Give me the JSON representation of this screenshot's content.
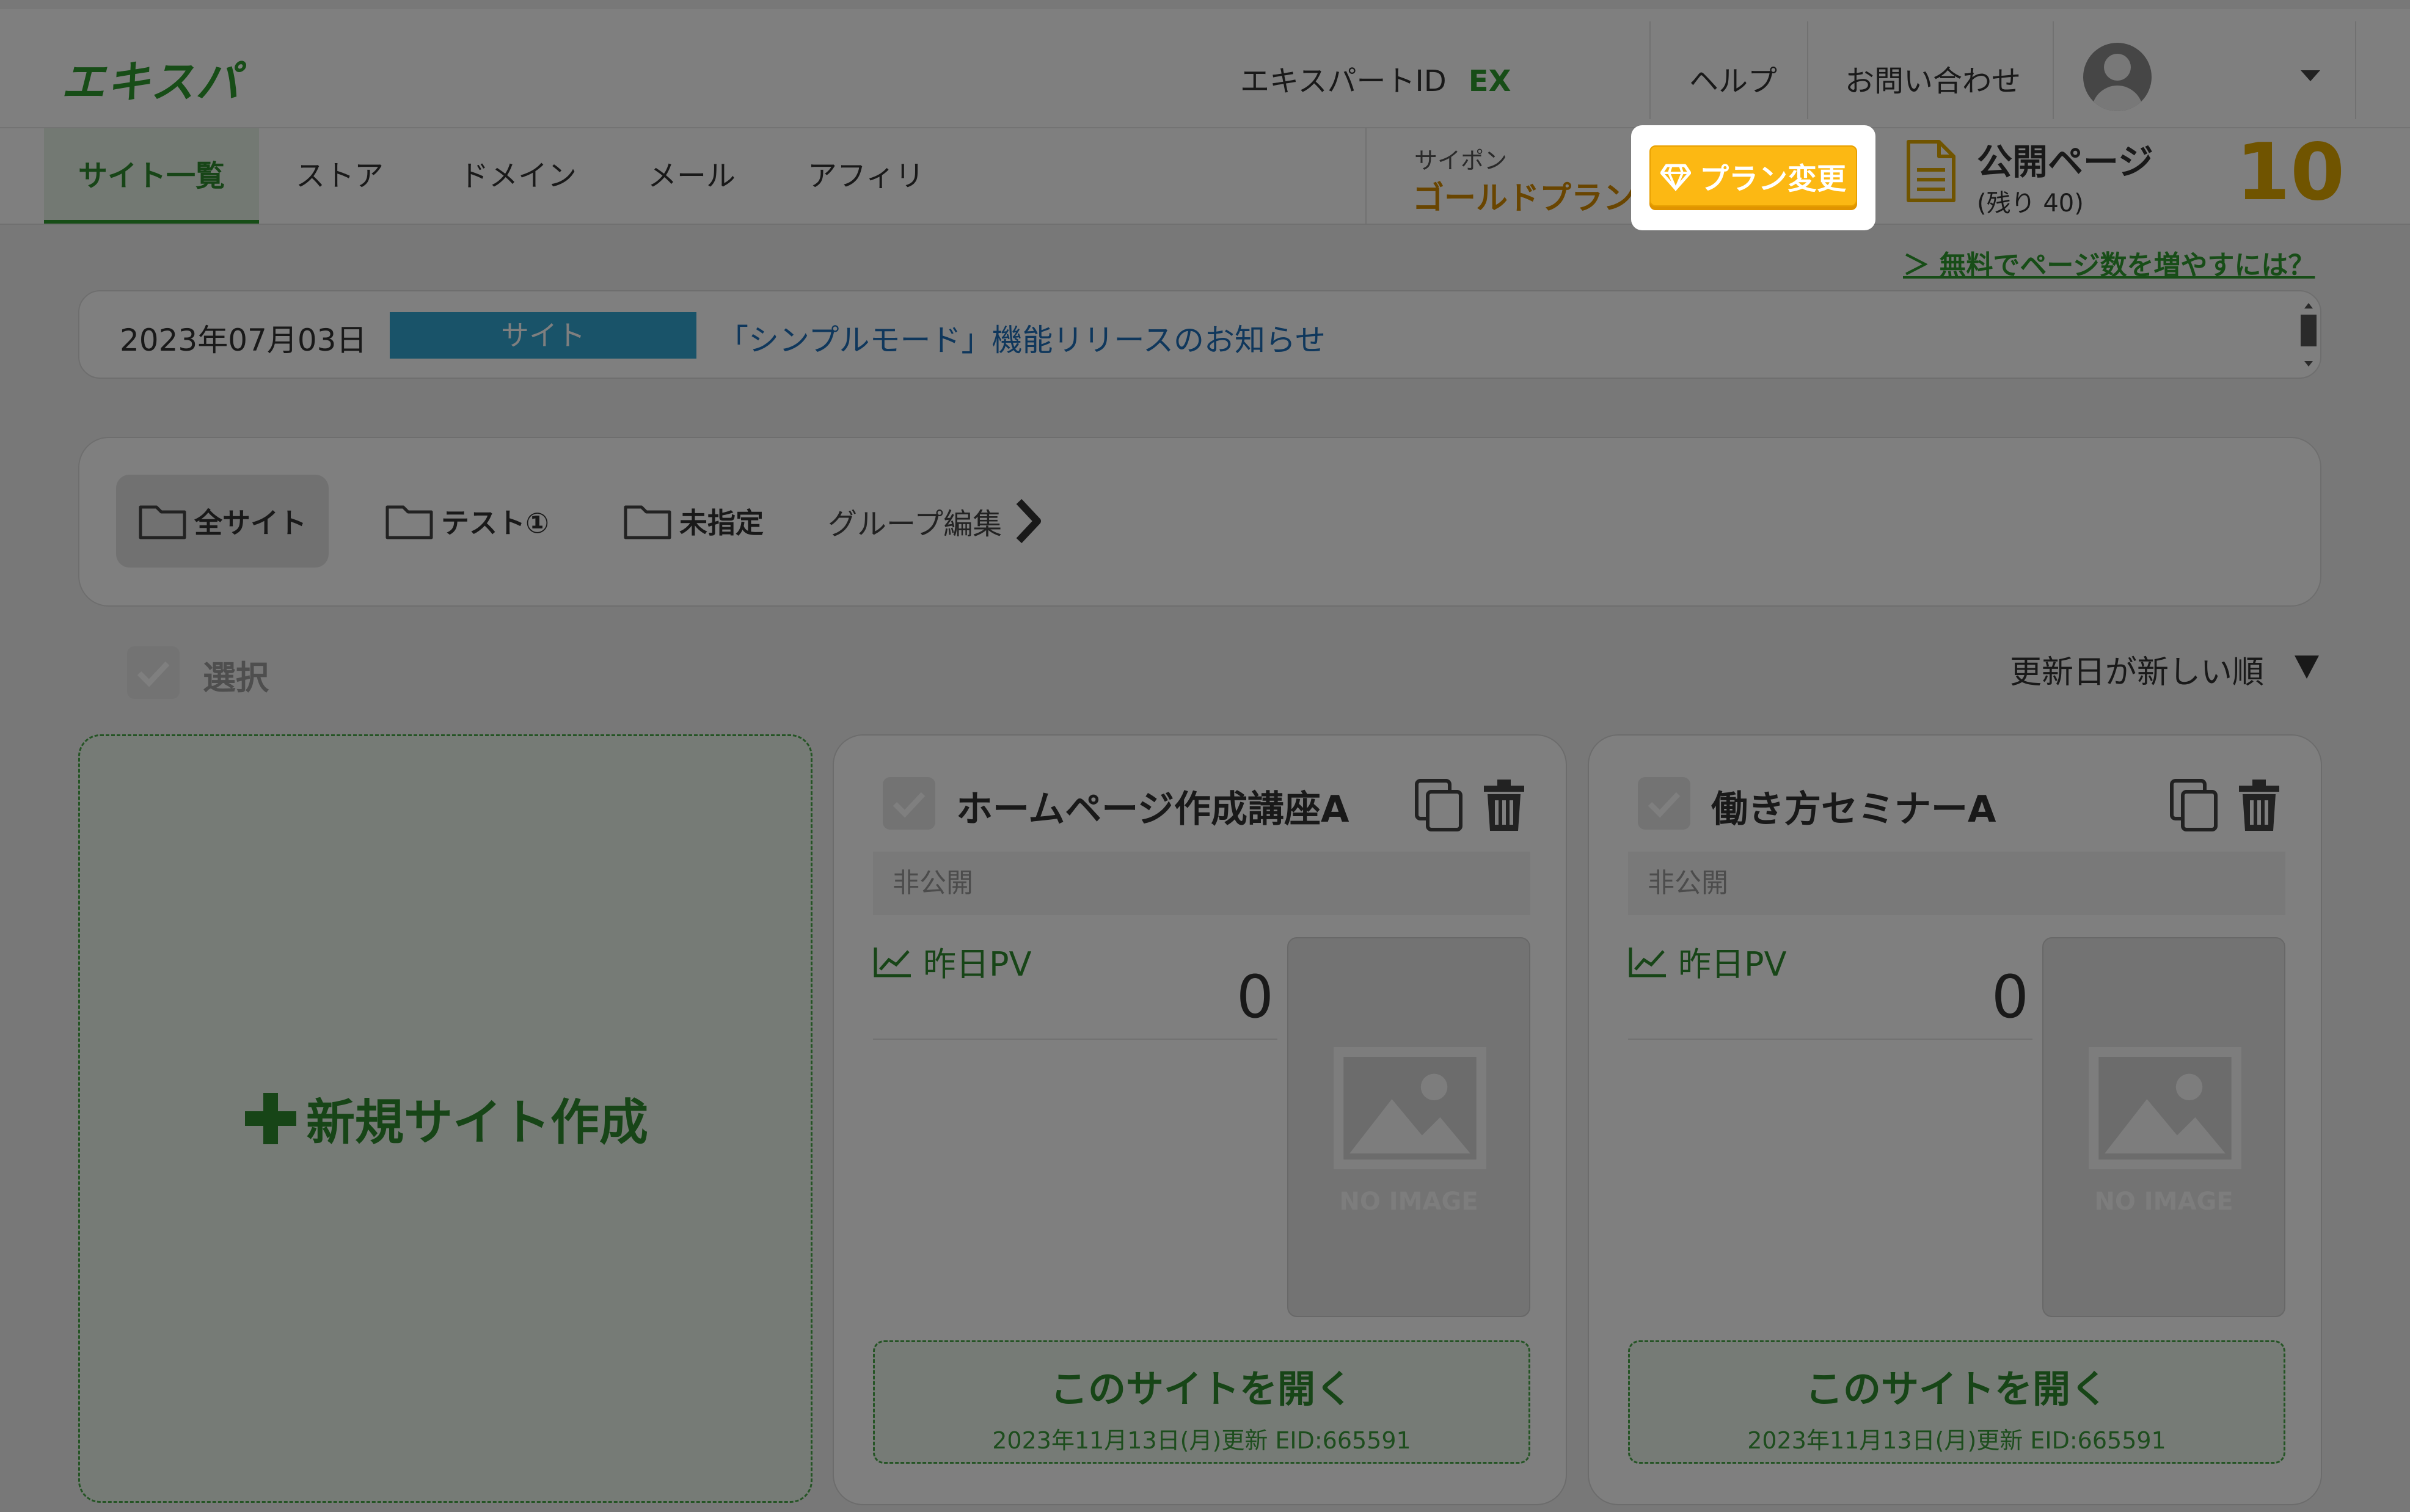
{
  "header": {
    "logo": "エキスパ",
    "expert_id_label": "エキスパートID",
    "expert_id_value": "EX",
    "help": "ヘルプ",
    "contact": "お問い合わせ"
  },
  "nav": {
    "items": [
      "サイト一覧",
      "ストア",
      "ドメイン",
      "メール",
      "アフィリ"
    ],
    "active_index": 0
  },
  "plan": {
    "label_top": "サイポン",
    "name": "ゴールドプラン",
    "change_button": "プラン変更"
  },
  "published": {
    "label": "公開ページ",
    "remaining": "(残り 40)",
    "count": "10"
  },
  "free_link": "＞ 無料でページ数を増やすには？",
  "news": {
    "date": "2023年07月03日",
    "tag": "サイト",
    "title": "「シンプルモード」機能リリースのお知らせ"
  },
  "groups": {
    "items": [
      "全サイト",
      "テスト①",
      "未指定"
    ],
    "edit": "グループ編集"
  },
  "list": {
    "select_label": "選択",
    "sort_label": "更新日が新しい順"
  },
  "new_site": "新規サイト作成",
  "sites": [
    {
      "title": "ホームページ作成講座A",
      "status": "非公開",
      "pv_label": "昨日PV",
      "pv_value": "0",
      "no_image": "NO IMAGE",
      "open_label": "このサイトを開く",
      "updated": "2023年11月13日(月)更新 EID:665591"
    },
    {
      "title": "働き方セミナーA",
      "status": "非公開",
      "pv_label": "昨日PV",
      "pv_value": "0",
      "no_image": "NO IMAGE",
      "open_label": "このサイトを開く",
      "updated": "2023年11月13日(月)更新 EID:665591"
    }
  ],
  "colors": {
    "brand_green": "#2e9b2e",
    "accent_orange": "#fcb813",
    "news_tag_blue": "#32a6d2",
    "page_count_gold": "#e0a800"
  }
}
